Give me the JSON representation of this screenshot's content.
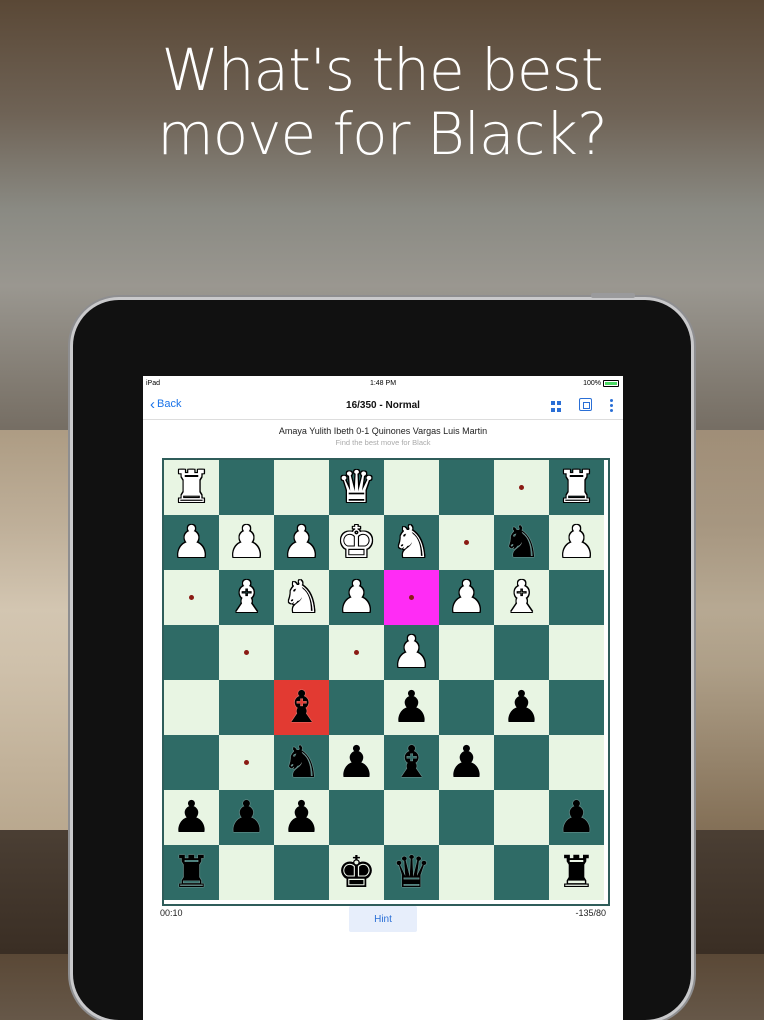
{
  "headline": "What's the best\nmove for Black?",
  "status_bar": {
    "device": "iPad",
    "time": "1:48 PM",
    "battery": "100%"
  },
  "nav": {
    "back_label": "Back",
    "title": "16/350 - Normal",
    "icons": [
      "grid-icon",
      "engine-chip-icon",
      "more-vertical-icon"
    ]
  },
  "game": {
    "players": "Amaya Yulith Ibeth 0-1 Quinones Vargas Luis Martin",
    "subtitle": "Find the best move for Black"
  },
  "board": {
    "orientation": "rank 1 at top (flipped view)",
    "squares": [
      [
        "wR",
        "",
        "",
        "wQ",
        "",
        "",
        "dot",
        "wR"
      ],
      [
        "wP",
        "wP",
        "wP",
        "wK",
        "wN",
        "dot",
        "bN",
        "wP"
      ],
      [
        "dot",
        "wB",
        "wN",
        "wP",
        "dot:hl-magenta",
        "wP",
        "wB",
        ""
      ],
      [
        "",
        "dot",
        "",
        "dot",
        "wP",
        "",
        "",
        ""
      ],
      [
        "",
        "",
        "bB:hl-red",
        "",
        "bP",
        "",
        "bP",
        ""
      ],
      [
        "",
        "dot",
        "bN",
        "bP",
        "bB",
        "bP",
        "",
        ""
      ],
      [
        "bP",
        "bP",
        "bP",
        "",
        "",
        "",
        "",
        "bP"
      ],
      [
        "bR",
        "",
        "",
        "bK",
        "bQ",
        "",
        "",
        "bR"
      ]
    ],
    "colors": {
      "light": "#e8f5e3",
      "dark": "#2f6b66",
      "highlight_target": "#ff2cf5",
      "highlight_selected": "#e23a32",
      "move_dot": "#8a1b14"
    }
  },
  "footer": {
    "timer": "00:10",
    "score": "-135/80",
    "hint_label": "Hint"
  }
}
